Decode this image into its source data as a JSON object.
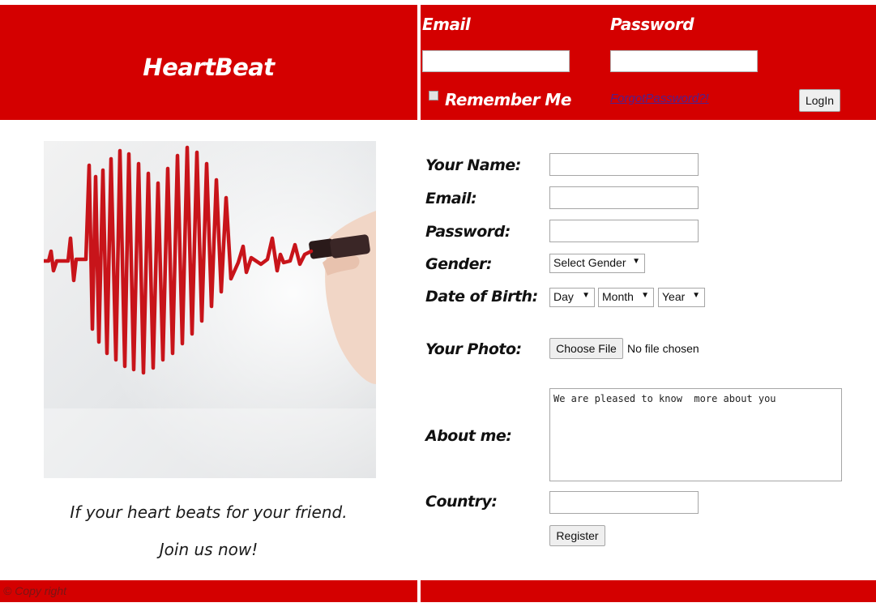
{
  "header": {
    "logo": "HeartBeat",
    "email_label": "Email",
    "password_label": "Password",
    "email_value": "",
    "password_value": "",
    "remember_label": "Remember Me",
    "forgot_label": "ForgotPassword?!",
    "login_label": "LogIn"
  },
  "hero": {
    "tagline1": "If your heart beats for your friend.",
    "tagline2": "Join us now!"
  },
  "form": {
    "name_label": "Your Name:",
    "email_label": "Email:",
    "password_label": "Password:",
    "gender_label": "Gender:",
    "gender_value": "Select Gender",
    "dob_label": "Date of Birth:",
    "day_value": "Day",
    "month_value": "Month",
    "year_value": "Year",
    "photo_label": "Your Photo:",
    "choose_file": "Choose File",
    "no_file": "No file chosen",
    "about_label": "About me:",
    "about_value": "We are pleased to know  more about you",
    "country_label": "Country:",
    "register_label": "Register"
  },
  "footer": {
    "copyright": "© Copy right"
  },
  "colors": {
    "brand_red": "#d40000",
    "link_purple": "#50208c",
    "heart_line": "#c8141a"
  },
  "icons": {
    "dropdown": "triangle-down",
    "checkbox": "square"
  }
}
